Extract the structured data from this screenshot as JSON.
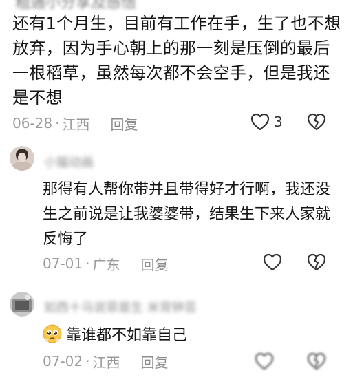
{
  "comment": {
    "top_cut_text": "粗通小分享及感悟",
    "text": "还有1个月生，目前有工作在手，生了也不想放弃，因为手心朝上的那一刻是压倒的最后一根稻草，虽然每次都不会空手，但是我还是不想",
    "date": "06-28",
    "location": "江西",
    "reply_label": "回复",
    "like_count": "3"
  },
  "replies": [
    {
      "name": "小猫动画",
      "text": "那得有人帮你带并且带得好才行啊，我还没生之前说是让我婆婆带，结果生下来人家就反悔了",
      "date": "07-01",
      "location": "广东",
      "reply_label": "回复"
    },
    {
      "name": "如西十马说菲是生  米背钟芸",
      "text": "靠谁都不如靠自己",
      "date": "07-02",
      "location": "江西",
      "reply_label": "回复"
    }
  ],
  "separator": "·",
  "colors": {
    "text": "#151515",
    "meta": "#9a9a9a",
    "icon": "#333333"
  },
  "icons": [
    "heart-outline-icon",
    "broken-heart-icon",
    "pleading-face-emoji"
  ]
}
